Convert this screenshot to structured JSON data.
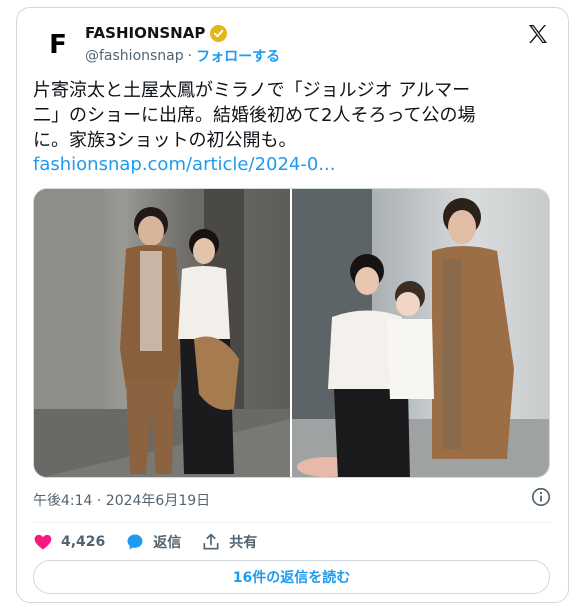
{
  "account": {
    "avatar_letter": "F",
    "display_name": "FASHIONSNAP",
    "handle": "@fashionsnap",
    "separator": "·",
    "follow_label": "フォローする",
    "verified_color": "#e2b719"
  },
  "tweet": {
    "text": "片寄涼太と土屋太鳳がミラノで「ジョルジオ アルマー\n二」のショーに出席。結婚後初めて2人そろって公の場\nに。家族3ショットの初公開も。",
    "link": "fashionsnap.com/article/2024-0...",
    "timestamp": "午後4:14 · 2024年6月19日"
  },
  "metrics": {
    "likes": "4,426",
    "reply_label": "返信",
    "share_label": "共有"
  },
  "read_replies_label": "16件の返信を読む",
  "colors": {
    "accent": "#1d9bf0",
    "like": "#f91880",
    "muted": "#536471"
  },
  "icons": [
    "x-logo-icon",
    "verified-badge-icon",
    "info-icon",
    "heart-icon",
    "reply-bubble-icon",
    "share-icon"
  ]
}
